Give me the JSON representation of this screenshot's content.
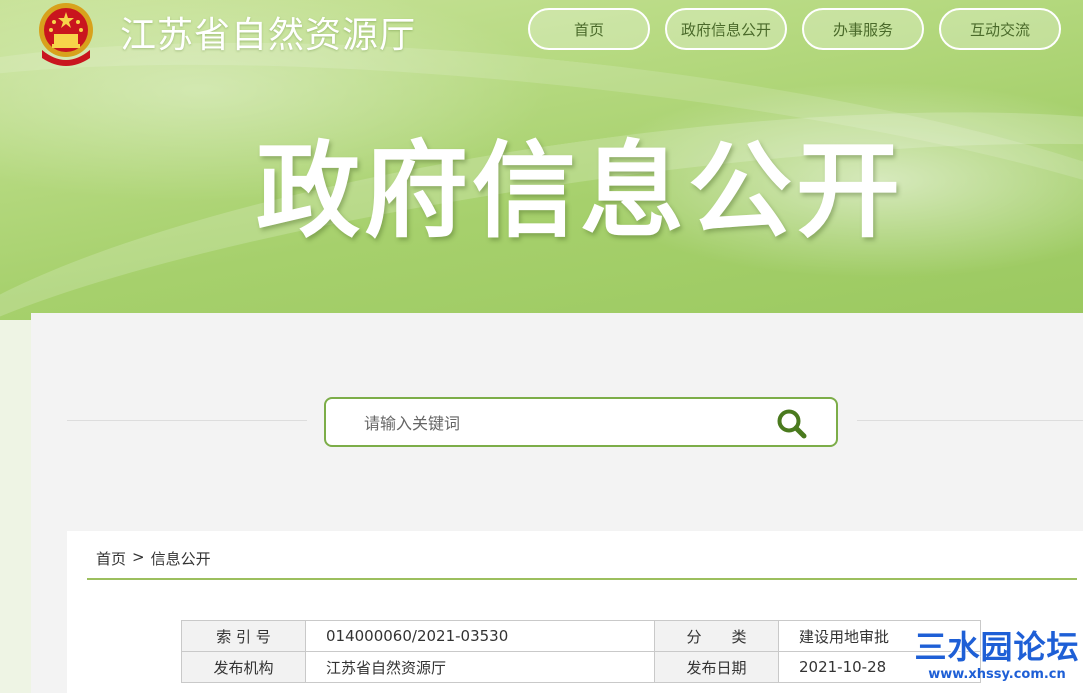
{
  "header": {
    "site_title": "江苏省自然资源厅",
    "nav": [
      "首页",
      "政府信息公开",
      "办事服务",
      "互动交流"
    ]
  },
  "hero": {
    "title": "政府信息公开"
  },
  "search": {
    "placeholder": "请输入关键词"
  },
  "breadcrumb": {
    "home": "首页",
    "separator": ">",
    "current": "信息公开"
  },
  "meta_table": {
    "rows": [
      {
        "label1": "索 引 号",
        "value1": "014000060/2021-03530",
        "label2": "分　　类",
        "value2": "建设用地审批"
      },
      {
        "label1": "发布机构",
        "value1": "江苏省自然资源厅",
        "label2": "发布日期",
        "value2": "2021-10-28"
      }
    ]
  },
  "watermark": {
    "main": "三水园论坛",
    "sub": "www.xhssy.com.cn"
  },
  "colors": {
    "accent_green": "#7cad48",
    "banner_green": "#a6d06c",
    "watermark_blue": "#1e5fd6"
  }
}
